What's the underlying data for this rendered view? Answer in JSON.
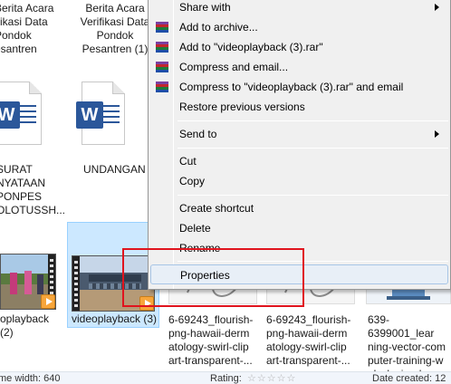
{
  "files": {
    "items": [
      {
        "label": "Berita Acara\nVerifikasi Data\nPondok\nPesantren (1)"
      },
      {
        "label": "Berita Acara\nifikasi Data\nPondok\nesantren"
      },
      {
        "label": "SURAT\nNYATAAN\nPONPES\nOLOTUSSH..."
      },
      {
        "label": "UNDANGAN"
      },
      {
        "label": "oplayback (2)"
      },
      {
        "label": "videoplayback (3)"
      },
      {
        "label": "6-69243_flourish-\npng-hawaii-derm\natology-swirl-clip\nart-transparent-..."
      },
      {
        "label": "6-69243_flourish-\npng-hawaii-derm\natology-swirl-clip\nart-transparent-..."
      },
      {
        "label": "639-6399001_lear\nning-vector-com\nputer-training-w\neb-design-ban..."
      }
    ],
    "word_letter": "W"
  },
  "status": {
    "frame_width": "me width:  640",
    "rating_label": "Rating:",
    "rating_stars": "☆☆☆☆☆",
    "date_created": "Date created: 12"
  },
  "menu": {
    "items": {
      "share_with": "Share with",
      "add_archive": "Add to archive...",
      "add_rar": "Add to \"videoplayback (3).rar\"",
      "compress_email": "Compress and email...",
      "compress_rar_email": "Compress to \"videoplayback (3).rar\" and email",
      "restore": "Restore previous versions",
      "send_to": "Send to",
      "cut": "Cut",
      "copy": "Copy",
      "create_shortcut": "Create shortcut",
      "delete": "Delete",
      "rename": "Rename",
      "properties": "Properties"
    },
    "icons": {
      "rar": "winrar-archive-icon",
      "submenu": "chevron-right-icon"
    }
  },
  "colors": {
    "highlight_box": "#e0141e",
    "selection": "#cce8ff",
    "word_blue": "#2b579a"
  }
}
